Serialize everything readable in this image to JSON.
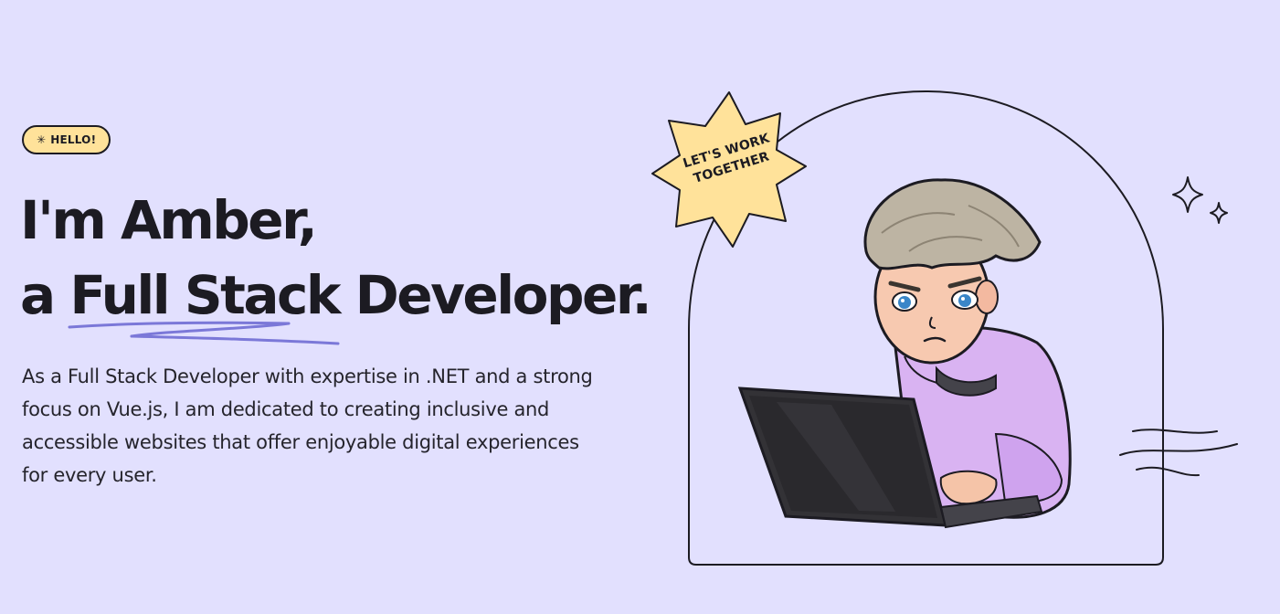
{
  "badge": {
    "icon": "sparkle-icon",
    "label": "HELLO!",
    "background": "#ffe29a"
  },
  "headline": {
    "line1": "I'm Amber,",
    "line2_prefix": "a ",
    "line2_highlight": "Full Stack",
    "line2_suffix": " Developer.",
    "underline_color": "#7b78d8"
  },
  "description": "As a Full Stack Developer with expertise in .NET and a strong focus on Vue.js, I am dedicated to creating inclusive and accessible websites that offer enjoyable digital experiences for every user.",
  "sticker": {
    "line1": "LET'S WORK",
    "line2": "TOGETHER",
    "background": "#ffe29a"
  },
  "illustration": {
    "character": "developer-with-laptop",
    "hoodie_color": "#d9b3f2"
  },
  "colors": {
    "page_background": "#e2e0fe",
    "text": "#1c1b22"
  }
}
